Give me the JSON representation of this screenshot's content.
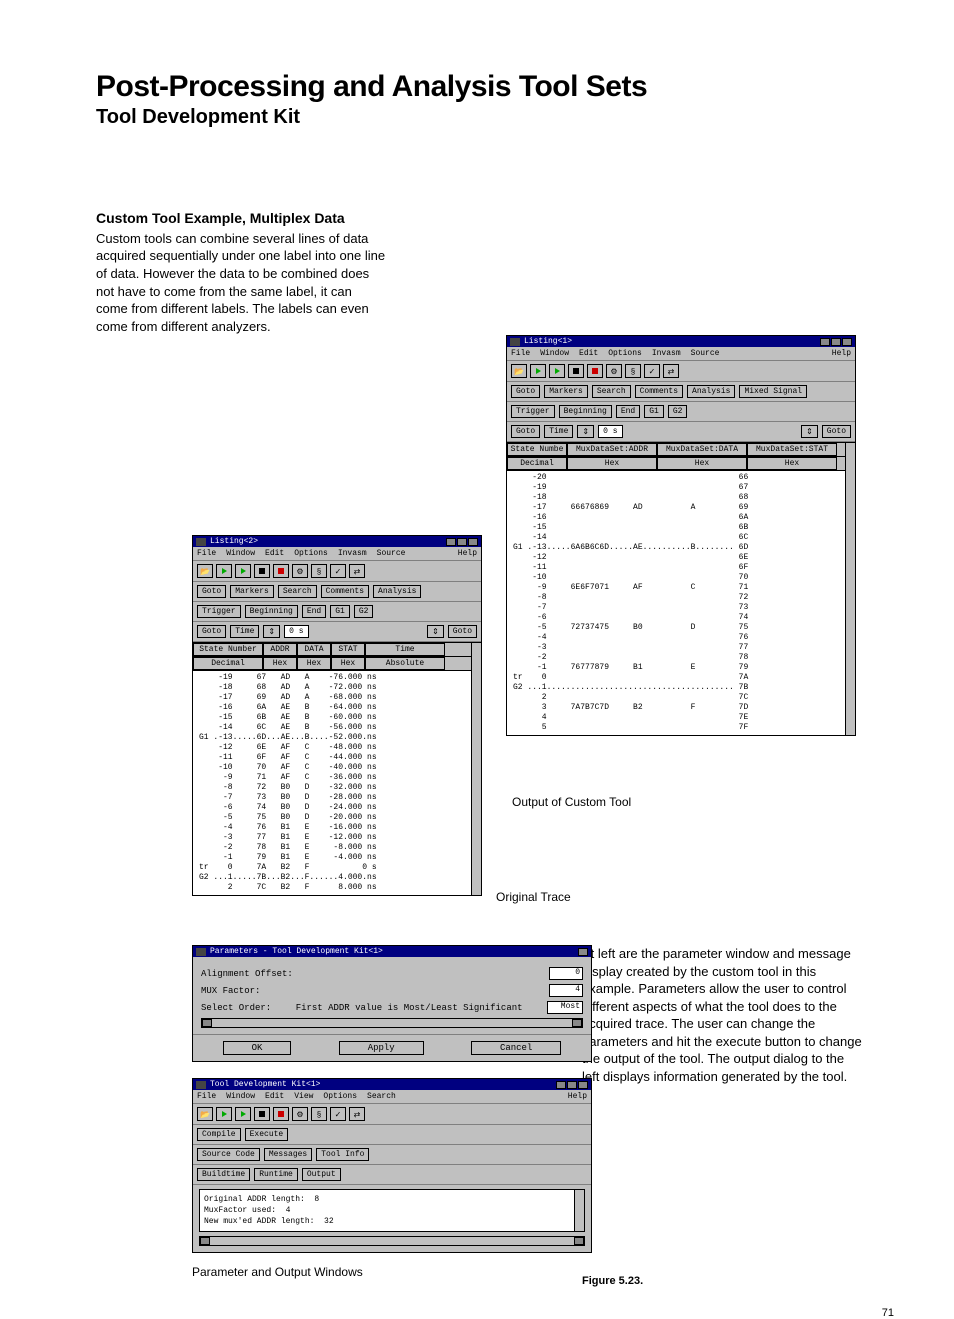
{
  "title": "Post-Processing and Analysis Tool Sets",
  "subtitle": "Tool Development Kit",
  "intro": {
    "lead": "Custom Tool Example, Multiplex Data",
    "body": "Custom tools can combine several lines of data acquired sequentially under one label into one line of data. However the data to be combined does not have to come from the same label, it can come from different labels. The labels can even come from different analyzers."
  },
  "menus": {
    "file": "File",
    "window": "Window",
    "edit": "Edit",
    "options": "Options",
    "invasm": "Invasm",
    "source": "Source",
    "view": "View",
    "search_m": "Search",
    "help": "Help"
  },
  "buttons": {
    "goto": "Goto",
    "markers": "Markers",
    "search": "Search",
    "comments": "Comments",
    "analysis": "Analysis",
    "mixed": "Mixed Signal",
    "trigger": "Trigger",
    "beginning": "Beginning",
    "end": "End",
    "g1": "G1",
    "g2": "G2",
    "goto_time": "Goto",
    "time": "Time",
    "zero": "0 s",
    "goto2": "Goto",
    "compile": "Compile",
    "execute": "Execute",
    "srccode": "Source Code",
    "messages": "Messages",
    "toolinfo": "Tool Info",
    "buildtime": "Buildtime",
    "runtime": "Runtime",
    "output": "Output",
    "ok": "OK",
    "apply": "Apply",
    "cancel": "Cancel"
  },
  "listing2": {
    "title": "Listing<2>",
    "hdr": {
      "c1": "State Number",
      "c2": "ADDR",
      "c3": "DATA",
      "c4": "STAT",
      "c5": "Time"
    },
    "sub": {
      "c1": "Decimal",
      "c2": "Hex",
      "c3": "Hex",
      "c4": "Hex",
      "c5": "Absolute"
    },
    "rows": [
      {
        "n": "-19",
        "a": "67",
        "d": "AD",
        "s": "A",
        "t": "-76.000 ns"
      },
      {
        "n": "-18",
        "a": "68",
        "d": "AD",
        "s": "A",
        "t": "-72.000 ns"
      },
      {
        "n": "-17",
        "a": "69",
        "d": "AD",
        "s": "A",
        "t": "-68.000 ns"
      },
      {
        "n": "-16",
        "a": "6A",
        "d": "AE",
        "s": "B",
        "t": "-64.000 ns"
      },
      {
        "n": "-15",
        "a": "6B",
        "d": "AE",
        "s": "B",
        "t": "-60.000 ns"
      },
      {
        "n": "-14",
        "a": "6C",
        "d": "AE",
        "s": "B",
        "t": "-56.000 ns"
      },
      {
        "n": "-13",
        "a": "6D",
        "d": "AE",
        "s": "B",
        "t": "-52.000 ns",
        "mark": "G1"
      },
      {
        "n": "-12",
        "a": "6E",
        "d": "AF",
        "s": "C",
        "t": "-48.000 ns"
      },
      {
        "n": "-11",
        "a": "6F",
        "d": "AF",
        "s": "C",
        "t": "-44.000 ns"
      },
      {
        "n": "-10",
        "a": "70",
        "d": "AF",
        "s": "C",
        "t": "-40.000 ns"
      },
      {
        "n": "-9",
        "a": "71",
        "d": "AF",
        "s": "C",
        "t": "-36.000 ns"
      },
      {
        "n": "-8",
        "a": "72",
        "d": "B0",
        "s": "D",
        "t": "-32.000 ns"
      },
      {
        "n": "-7",
        "a": "73",
        "d": "B0",
        "s": "D",
        "t": "-28.000 ns"
      },
      {
        "n": "-6",
        "a": "74",
        "d": "B0",
        "s": "D",
        "t": "-24.000 ns"
      },
      {
        "n": "-5",
        "a": "75",
        "d": "B0",
        "s": "D",
        "t": "-20.000 ns"
      },
      {
        "n": "-4",
        "a": "76",
        "d": "B1",
        "s": "E",
        "t": "-16.000 ns"
      },
      {
        "n": "-3",
        "a": "77",
        "d": "B1",
        "s": "E",
        "t": "-12.000 ns"
      },
      {
        "n": "-2",
        "a": "78",
        "d": "B1",
        "s": "E",
        "t": "-8.000 ns"
      },
      {
        "n": "-1",
        "a": "79",
        "d": "B1",
        "s": "E",
        "t": "-4.000 ns"
      },
      {
        "n": "0",
        "a": "7A",
        "d": "B2",
        "s": "F",
        "t": "0 s",
        "mark": "tr"
      },
      {
        "n": "1",
        "a": "7B",
        "d": "B2",
        "s": "F",
        "t": "4.000 ns",
        "mark": "G2"
      },
      {
        "n": "2",
        "a": "7C",
        "d": "B2",
        "s": "F",
        "t": "8.000 ns"
      }
    ]
  },
  "listing1": {
    "title": "Listing<1>",
    "hdr": {
      "c1": "State Numbe",
      "c2": "MuxDataSet:ADDR",
      "c3": "MuxDataSet:DATA",
      "c4": "MuxDataSet:STAT"
    },
    "sub": {
      "c1": "Decimal",
      "c2": "Hex",
      "c3": "Hex",
      "c4": "Hex"
    },
    "side": [
      "66",
      "67",
      "68",
      "69",
      "6A",
      "6B",
      "6C",
      "6D",
      "6E",
      "6F",
      "70",
      "71",
      "72",
      "73",
      "74",
      "75",
      "76",
      "77",
      "78",
      "79",
      "7A",
      "7B",
      "7C",
      "7D",
      "7E",
      "7F"
    ],
    "rows": [
      {
        "n": "-20"
      },
      {
        "n": "-19"
      },
      {
        "n": "-18"
      },
      {
        "n": "-17",
        "a": "66676869",
        "d": "AD",
        "s": "A"
      },
      {
        "n": "-16"
      },
      {
        "n": "-15"
      },
      {
        "n": "-14"
      },
      {
        "n": "-13",
        "a": "6A6B6C6D",
        "d": "AE",
        "s": "B",
        "mark": "G1"
      },
      {
        "n": "-12"
      },
      {
        "n": "-11"
      },
      {
        "n": "-10"
      },
      {
        "n": "-9",
        "a": "6E6F7071",
        "d": "AF",
        "s": "C"
      },
      {
        "n": "-8"
      },
      {
        "n": "-7"
      },
      {
        "n": "-6"
      },
      {
        "n": "-5",
        "a": "72737475",
        "d": "B0",
        "s": "D"
      },
      {
        "n": "-4"
      },
      {
        "n": "-3"
      },
      {
        "n": "-2"
      },
      {
        "n": "-1",
        "a": "76777879",
        "d": "B1",
        "s": "E"
      },
      {
        "n": "0",
        "mark": "tr"
      },
      {
        "n": "1",
        "mark": "G2"
      },
      {
        "n": "2"
      },
      {
        "n": "3",
        "a": "7A7B7C7D",
        "d": "B2",
        "s": "F"
      },
      {
        "n": "4"
      },
      {
        "n": "5"
      }
    ]
  },
  "captions": {
    "output": "Output of Custom Tool",
    "original": "Original Trace",
    "paramout": "Parameter and Output Windows",
    "figure": "Figure 5.23."
  },
  "rtext": "At left are the parameter window and message display created by the custom tool in this example. Parameters allow the user to control different aspects of what the tool does to the acquired trace.  The user can change the parameters and hit the execute button to change the output of the tool. The output dialog to the left displays information generated by the tool.",
  "param": {
    "title": "Parameters - Tool Development Kit<1>",
    "r1": "Alignment Offset:",
    "v1": "0",
    "r2": "MUX Factor:",
    "v2": "4",
    "r3a": "Select Order:",
    "r3b": "First ADDR value is Most/Least Significant",
    "v3": "Most"
  },
  "tdk": {
    "title": "Tool Development Kit<1>",
    "msg": "Original ADDR length:  8\nMuxFactor used:  4\nNew mux'ed ADDR length:  32"
  },
  "pagenum": "71"
}
